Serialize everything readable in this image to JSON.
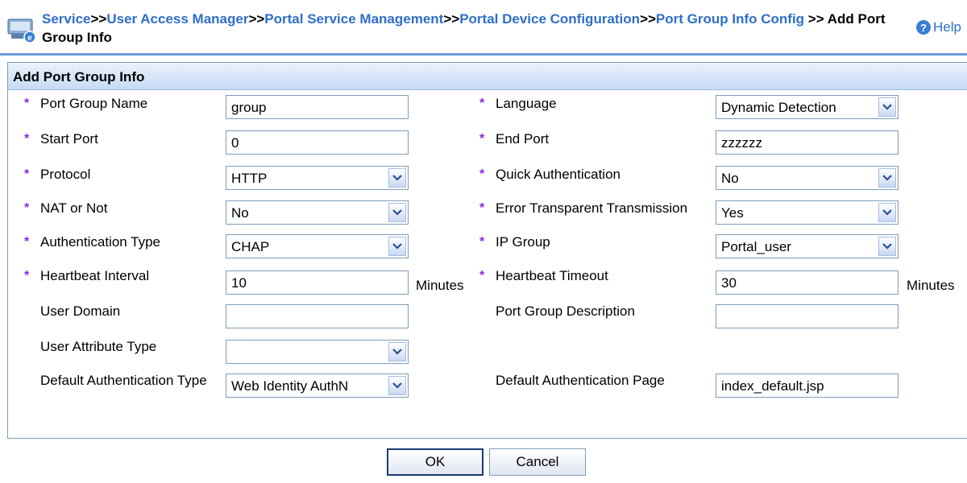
{
  "header": {
    "breadcrumbs": [
      {
        "label": "Service",
        "link": true
      },
      {
        "label": ">>",
        "link": false
      },
      {
        "label": "User Access Manager",
        "link": true
      },
      {
        "label": ">>",
        "link": false
      },
      {
        "label": "Portal Service Management",
        "link": true
      },
      {
        "label": ">>",
        "link": false
      },
      {
        "label": "Portal Device Configuration",
        "link": true
      },
      {
        "label": ">>",
        "link": false
      },
      {
        "label": "Port Group Info Config",
        "link": true
      },
      {
        "label": " >> Add Port Group Info",
        "link": false
      }
    ],
    "help_label": "Help",
    "help_icon": "question-circle-icon"
  },
  "panel": {
    "title": "Add Port Group Info"
  },
  "fields": {
    "port_group_name": {
      "label": "Port Group Name",
      "value": "group"
    },
    "language": {
      "label": "Language",
      "value": "Dynamic Detection"
    },
    "start_port": {
      "label": "Start Port",
      "value": "0"
    },
    "end_port": {
      "label": "End Port",
      "value": "zzzzzz"
    },
    "protocol": {
      "label": "Protocol",
      "value": "HTTP"
    },
    "quick_auth": {
      "label": "Quick Authentication",
      "value": "No"
    },
    "nat": {
      "label": "NAT or Not",
      "value": "No"
    },
    "error_transparent": {
      "label": "Error Transparent Transmission",
      "value": "Yes"
    },
    "auth_type": {
      "label": "Authentication Type",
      "value": "CHAP"
    },
    "ip_group": {
      "label": "IP Group",
      "value": "Portal_user"
    },
    "heartbeat_interval": {
      "label": "Heartbeat Interval",
      "value": "10",
      "unit": "Minutes"
    },
    "heartbeat_timeout": {
      "label": "Heartbeat Timeout",
      "value": "30",
      "unit": "Minutes"
    },
    "user_domain": {
      "label": "User Domain",
      "value": ""
    },
    "port_group_desc": {
      "label": "Port Group Description",
      "value": ""
    },
    "user_attr_type": {
      "label": "User Attribute Type",
      "value": ""
    },
    "default_auth_type": {
      "label": "Default Authentication Type",
      "value": "Web Identity AuthN"
    },
    "default_auth_page": {
      "label": "Default Authentication Page",
      "value": "index_default.jsp"
    }
  },
  "required_marker": "*",
  "buttons": {
    "ok": "OK",
    "cancel": "Cancel"
  },
  "colors": {
    "link": "#2f6ec9",
    "required": "#8a2be2",
    "panel_header": "#c6dbf5"
  }
}
